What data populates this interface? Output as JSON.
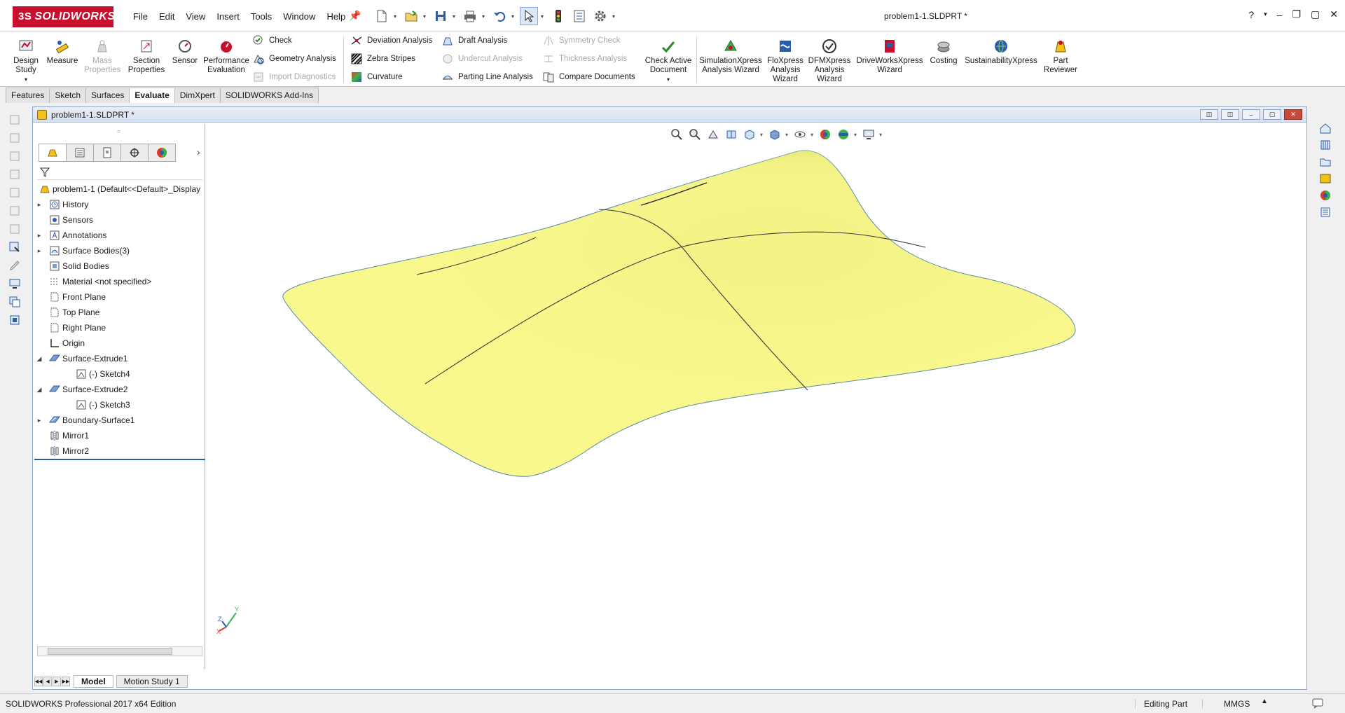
{
  "app": {
    "brand": "SOLIDWORKS",
    "brand_prefix": "3S",
    "document_title": "problem1-1.SLDPRT *",
    "menus": [
      "File",
      "Edit",
      "View",
      "Insert",
      "Tools",
      "Window",
      "Help"
    ],
    "help_glyph": "?",
    "colors": {
      "brand": "#c8102e",
      "surface": "#f7f78a",
      "active_tab": "#ffffff",
      "tree_accent": "#2a5ea8"
    }
  },
  "command_manager": {
    "design_study": "Design Study",
    "measure": "Measure",
    "mass_properties": "Mass Properties",
    "section_properties": "Section Properties",
    "sensor": "Sensor",
    "performance_evaluation": "Performance Evaluation",
    "check": "Check",
    "geometry_analysis": "Geometry Analysis",
    "import_diagnostics": "Import Diagnostics",
    "deviation_analysis": "Deviation Analysis",
    "zebra_stripes": "Zebra Stripes",
    "curvature": "Curvature",
    "draft_analysis": "Draft Analysis",
    "undercut_analysis": "Undercut Analysis",
    "parting_line_analysis": "Parting Line Analysis",
    "symmetry_check": "Symmetry Check",
    "thickness_analysis": "Thickness Analysis",
    "compare_documents": "Compare Documents",
    "check_active_document": "Check Active Document",
    "simulationxpress": "SimulationXpress Analysis Wizard",
    "floxpress": "FloXpress Analysis Wizard",
    "dfmxpress": "DFMXpress Analysis Wizard",
    "driveworksxpress": "DriveWorksXpress Wizard",
    "costing": "Costing",
    "sustainabilityxpress": "SustainabilityXpress",
    "part_reviewer": "Part Reviewer"
  },
  "command_tabs": [
    "Features",
    "Sketch",
    "Surfaces",
    "Evaluate",
    "DimXpert",
    "SOLIDWORKS Add-Ins"
  ],
  "active_command_tab": "Evaluate",
  "document_window": {
    "title": "problem1-1.SLDPRT *"
  },
  "feature_tree": {
    "root": "problem1-1  (Default<<Default>_Display",
    "items": [
      {
        "label": "History",
        "icon": "history-icon",
        "expandable": true,
        "state": "collapsed",
        "level": 1
      },
      {
        "label": "Sensors",
        "icon": "sensors-icon",
        "expandable": false,
        "level": 1
      },
      {
        "label": "Annotations",
        "icon": "annotations-icon",
        "expandable": true,
        "state": "collapsed",
        "level": 1
      },
      {
        "label": "Surface Bodies(3)",
        "icon": "surface-bodies-icon",
        "expandable": true,
        "state": "collapsed",
        "level": 1
      },
      {
        "label": "Solid Bodies",
        "icon": "solid-bodies-icon",
        "expandable": false,
        "level": 1
      },
      {
        "label": "Material <not specified>",
        "icon": "material-icon",
        "expandable": false,
        "level": 1
      },
      {
        "label": "Front Plane",
        "icon": "plane-icon",
        "expandable": false,
        "level": 1
      },
      {
        "label": "Top Plane",
        "icon": "plane-icon",
        "expandable": false,
        "level": 1
      },
      {
        "label": "Right Plane",
        "icon": "plane-icon",
        "expandable": false,
        "level": 1
      },
      {
        "label": "Origin",
        "icon": "origin-icon",
        "expandable": false,
        "level": 1
      },
      {
        "label": "Surface-Extrude1",
        "icon": "surface-extrude-icon",
        "expandable": true,
        "state": "expanded",
        "level": 1
      },
      {
        "label": "(-) Sketch4",
        "icon": "sketch-icon",
        "expandable": false,
        "level": 2
      },
      {
        "label": "Surface-Extrude2",
        "icon": "surface-extrude-icon",
        "expandable": true,
        "state": "expanded",
        "level": 1
      },
      {
        "label": "(-) Sketch3",
        "icon": "sketch-icon",
        "expandable": false,
        "level": 2
      },
      {
        "label": "Boundary-Surface1",
        "icon": "boundary-surface-icon",
        "expandable": true,
        "state": "collapsed",
        "level": 1
      },
      {
        "label": "Mirror1",
        "icon": "mirror-icon",
        "expandable": false,
        "level": 1
      },
      {
        "label": "Mirror2",
        "icon": "mirror-icon",
        "expandable": false,
        "level": 1
      }
    ]
  },
  "bottom_tabs": [
    "Model",
    "Motion Study 1"
  ],
  "active_bottom_tab": "Model",
  "triad": {
    "x": "X",
    "y": "Y",
    "z": "Z"
  },
  "status_bar": {
    "product": "SOLIDWORKS Professional 2017 x64 Edition",
    "mode": "Editing Part",
    "units": "MMGS"
  }
}
